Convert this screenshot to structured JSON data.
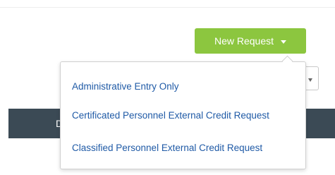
{
  "toolbar": {
    "new_request_label": "New Request",
    "new_request_icon": "caret-down-icon",
    "button_color": "#8cc63f"
  },
  "dropdown": {
    "items": [
      {
        "label": "Administrative Entry Only"
      },
      {
        "label": "Certificated Personnel External Credit Request"
      },
      {
        "label": "Classified Personnel External Credit Request"
      }
    ],
    "link_color": "#1f5aa6"
  },
  "table_header": {
    "partial_text": "D",
    "background_color": "#3b4a55"
  }
}
